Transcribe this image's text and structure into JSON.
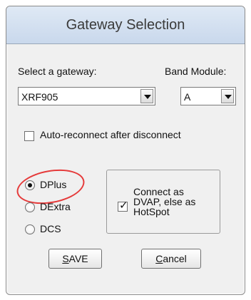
{
  "window": {
    "title": "Gateway Selection"
  },
  "gateway": {
    "label": "Select a gateway:",
    "selected": "XRF905"
  },
  "band_module": {
    "label": "Band Module:",
    "selected": "A"
  },
  "auto_reconnect": {
    "label": "Auto-reconnect after disconnect",
    "checked": false
  },
  "protocol": {
    "selected": "DPlus",
    "options": [
      {
        "label": "DPlus"
      },
      {
        "label": "DExtra"
      },
      {
        "label": "DCS"
      }
    ]
  },
  "connect_as": {
    "label": "Connect as\nDVAP, else as\nHotSpot",
    "checked": true
  },
  "buttons": {
    "save_accel": "S",
    "save_rest": "AVE",
    "cancel_accel": "C",
    "cancel_rest": "ancel"
  },
  "colors": {
    "highlight": "#e53a3a"
  }
}
